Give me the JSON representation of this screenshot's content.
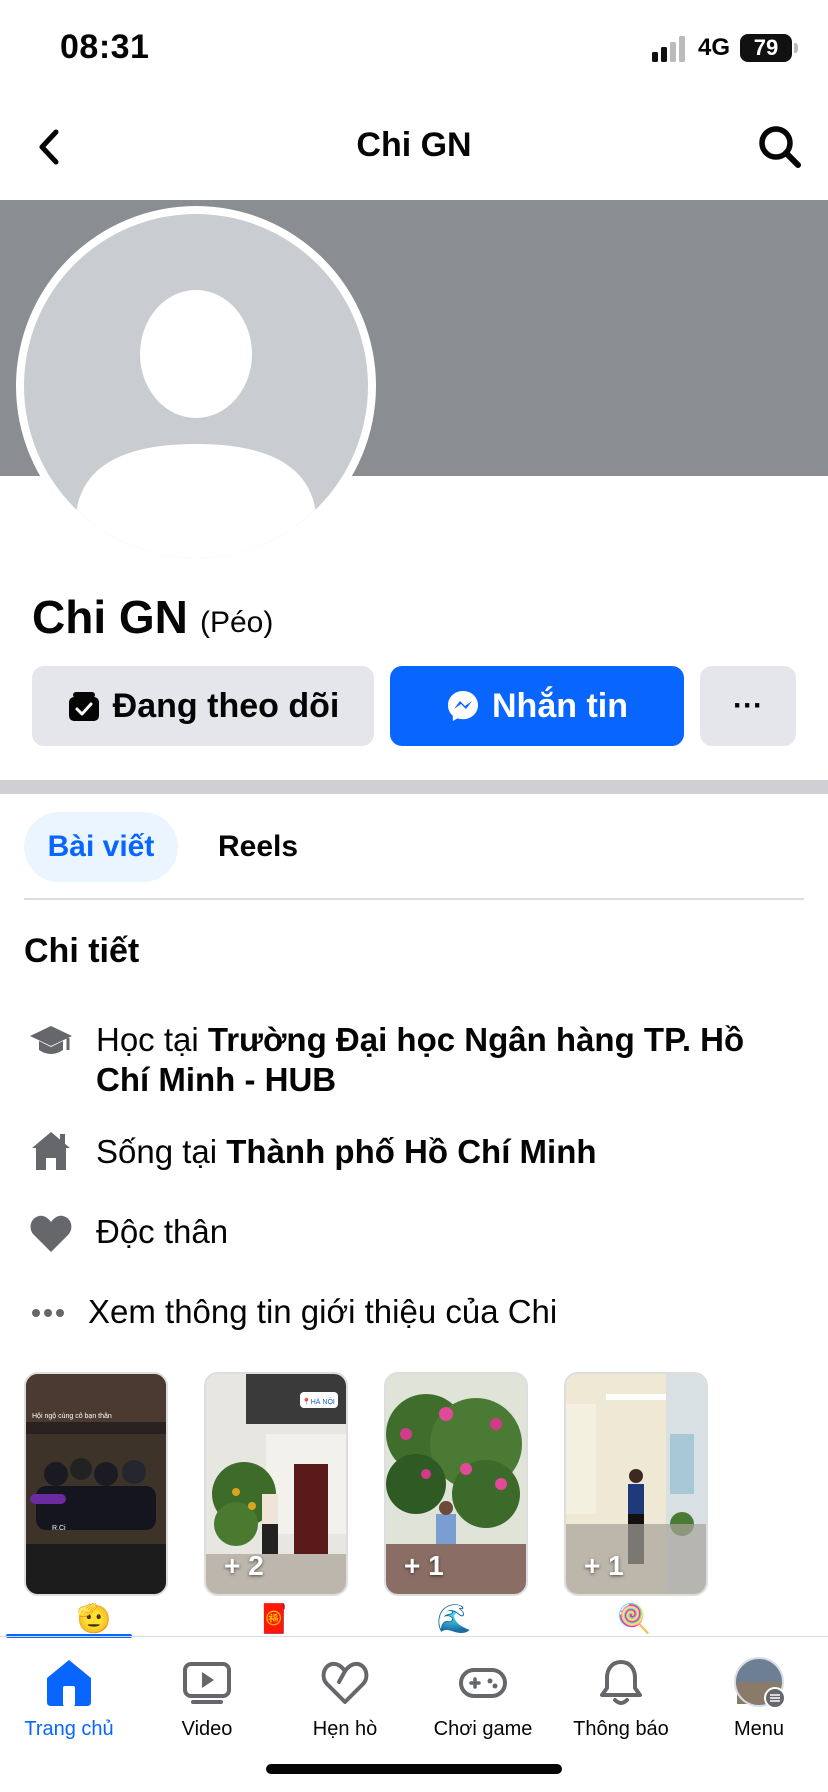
{
  "status_bar": {
    "time": "08:31",
    "network": "4G",
    "battery": "79"
  },
  "header": {
    "title": "Chi GN",
    "back_icon": "chevron-left-icon",
    "search_icon": "search-icon"
  },
  "profile": {
    "name": "Chi GN",
    "nickname": "(Péo)",
    "buttons": {
      "follow": "Đang theo dõi",
      "message": "Nhắn tin",
      "more": "···"
    }
  },
  "tabs": [
    {
      "label": "Bài viết",
      "active": true
    },
    {
      "label": "Reels",
      "active": false
    }
  ],
  "details": {
    "title": "Chi tiết",
    "items": [
      {
        "icon": "graduation-cap-icon",
        "prefix": "Học tại ",
        "bold": "Trường Đại học Ngân hàng TP. Hồ Chí Minh - HUB"
      },
      {
        "icon": "home-icon",
        "prefix": "Sống tại ",
        "bold": "Thành phố Hồ Chí Minh"
      },
      {
        "icon": "heart-icon",
        "prefix": "Độc thân",
        "bold": ""
      },
      {
        "icon": "more-dots-icon",
        "prefix": "Xem thông tin giới thiệu của Chi",
        "bold": ""
      }
    ]
  },
  "highlights": [
    {
      "count": "",
      "emoji": "🫡",
      "photo_text": "Hội ngộ cùng cô bạn thân",
      "caption": "R.Ci"
    },
    {
      "count": "+ 2",
      "emoji": "🧧",
      "sticker": "📍HÀ NỘI"
    },
    {
      "count": "+ 1",
      "emoji": "🌊"
    },
    {
      "count": "+ 1",
      "emoji": "🍭"
    }
  ],
  "bottom_nav": [
    {
      "label": "Trang chủ",
      "icon": "home-icon",
      "active": true
    },
    {
      "label": "Video",
      "icon": "video-icon",
      "active": false
    },
    {
      "label": "Hẹn hò",
      "icon": "dating-heart-icon",
      "active": false
    },
    {
      "label": "Chơi game",
      "icon": "gamepad-icon",
      "active": false
    },
    {
      "label": "Thông báo",
      "icon": "bell-icon",
      "active": false
    },
    {
      "label": "Menu",
      "icon": "avatar-menu-icon",
      "active": false
    }
  ],
  "colors": {
    "accent": "#0866ff",
    "cover": "#8a8d91",
    "button_gray": "#e4e6eb",
    "tab_active_bg": "#ebf5ff"
  }
}
